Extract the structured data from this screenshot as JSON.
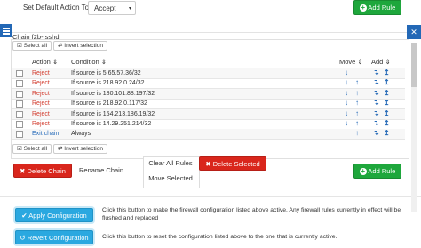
{
  "header": {
    "default_action_label": "Set Default Action To:",
    "default_action_value": "Accept",
    "add_rule_label": "Add Rule"
  },
  "chain": {
    "title": "Chain f2b- sshd",
    "select_all": "Select all",
    "invert_selection": "Invert selection",
    "columns": {
      "action": "Action",
      "condition": "Condition",
      "move": "Move",
      "add": "Add"
    },
    "rules": [
      {
        "action": "Reject",
        "condition": "If source is 5.65.57.36/32",
        "kind": "reject"
      },
      {
        "action": "Reject",
        "condition": "If source is 218.92.0.24/32",
        "kind": "reject"
      },
      {
        "action": "Reject",
        "condition": "If source is 180.101.88.197/32",
        "kind": "reject"
      },
      {
        "action": "Reject",
        "condition": "If source is 218.92.0.117/32",
        "kind": "reject"
      },
      {
        "action": "Reject",
        "condition": "If source is 154.213.186.19/32",
        "kind": "reject"
      },
      {
        "action": "Reject",
        "condition": "If source is 14.29.251.214/32",
        "kind": "reject"
      },
      {
        "action": "Exit chain",
        "condition": "Always",
        "kind": "exit"
      }
    ],
    "icons": {
      "move_down": "↓",
      "move_up": "↑",
      "add_below": "↴",
      "add_above": "↥"
    }
  },
  "chain_actions": {
    "delete_chain": "Delete Chain",
    "rename_chain": "Rename Chain",
    "clear_all_rules": "Clear All Rules",
    "delete_selected": "Delete Selected",
    "move_selected": "Move Selected",
    "add_rule": "Add Rule"
  },
  "config": {
    "apply_label": "Apply Configuration",
    "apply_desc": "Click this button to make the firewall configuration listed above active. Any firewall rules currently in effect will be flushed and replaced",
    "revert_label": "Revert Configuration",
    "revert_desc": "Click this button to reset the configuration listed above to the one that is currently active."
  },
  "colors": {
    "green": "#1ea73c",
    "red": "#d9261c",
    "blue": "#2aa8e0",
    "nav_blue": "#2368b6",
    "reject_text": "#d23a2c",
    "exit_text": "#2a6ebb"
  },
  "sidebar": {
    "menu_icon": "hamburger-icon",
    "close_icon": "close-icon"
  }
}
